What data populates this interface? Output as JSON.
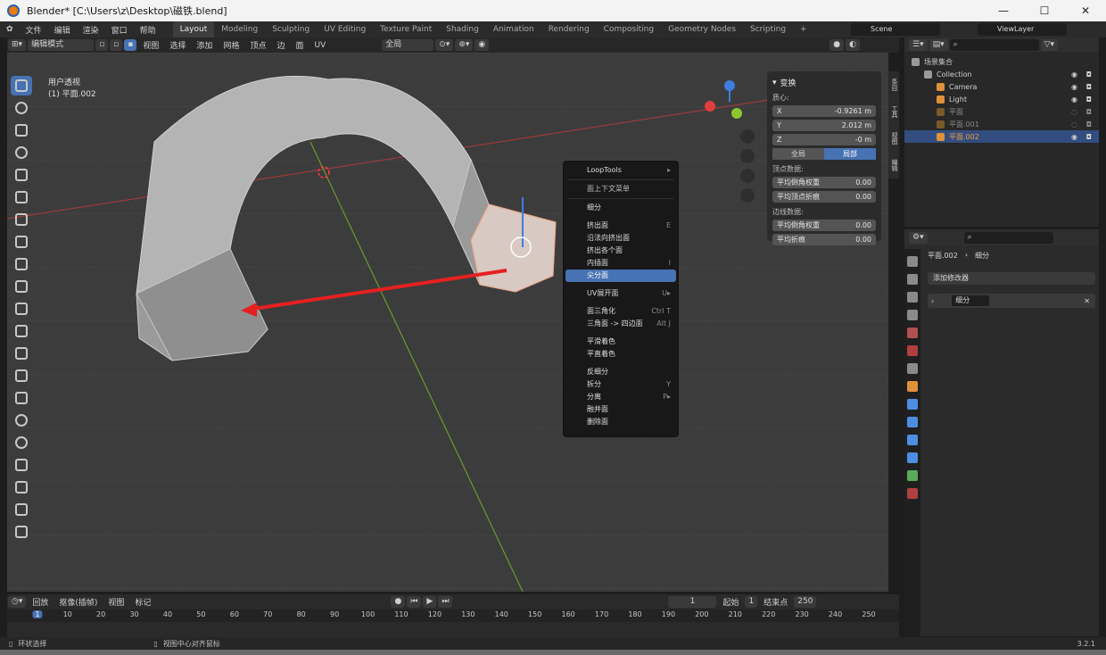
{
  "window": {
    "title": "Blender* [C:\\Users\\z\\Desktop\\磁铁.blend]",
    "controls": [
      "—",
      "☐",
      "✕"
    ]
  },
  "menubar": {
    "items": [
      "文件",
      "编辑",
      "渲染",
      "窗口",
      "帮助"
    ]
  },
  "workspaces": [
    "Layout",
    "Modeling",
    "Sculpting",
    "UV Editing",
    "Texture Paint",
    "Shading",
    "Animation",
    "Rendering",
    "Compositing",
    "Geometry Nodes",
    "Scripting",
    "+"
  ],
  "scene": {
    "name": "Scene",
    "view_layer": "ViewLayer"
  },
  "viewport_header": {
    "mode": "编辑模式",
    "menus": [
      "视图",
      "选择",
      "添加",
      "网格",
      "顶点",
      "边",
      "面",
      "UV"
    ],
    "transform": "全局",
    "options": "选项",
    "axes": [
      "X",
      "Y",
      "Z"
    ]
  },
  "viewport": {
    "view_name": "用户透视",
    "object_name": "(1) 平面.002"
  },
  "npanel": {
    "section": "变换",
    "median_label": "质心:",
    "x_label": "X",
    "x_value": "-0.9261 m",
    "y_label": "Y",
    "y_value": "2.012 m",
    "z_label": "Z",
    "z_value": "-0 m",
    "global": "全局",
    "local": "局部",
    "vertex_data": "顶点数据:",
    "mean_bevel_weight": "平均倒角权重",
    "mean_bevel_weight_value": "0.00",
    "mean_vertex_crease": "平均顶点折痕",
    "mean_vertex_crease_value": "0.00",
    "edge_data": "边线数据:",
    "edge_bevel_weight": "平均倒角权重",
    "edge_bevel_weight_value": "0.00",
    "edge_crease": "平均折痕",
    "edge_crease_value": "0.00",
    "side_tabs": [
      "条目",
      "工具",
      "视图",
      "编辑"
    ]
  },
  "context_menu": {
    "items": [
      {
        "label": "LoopTools",
        "shortcut": "▸"
      },
      {
        "label": "面上下文菜单",
        "shortcut": ""
      },
      {
        "label": "细分",
        "shortcut": ""
      },
      {
        "label": "挤出面",
        "shortcut": "E"
      },
      {
        "label": "沿法向挤出面",
        "shortcut": ""
      },
      {
        "label": "挤出各个面",
        "shortcut": ""
      },
      {
        "label": "内插面",
        "shortcut": "I"
      },
      {
        "label": "尖分面",
        "shortcut": ""
      },
      {
        "label": "UV展开面",
        "shortcut": "U▸"
      },
      {
        "label": "面三角化",
        "shortcut": "Ctrl T"
      },
      {
        "label": "三角面 -> 四边面",
        "shortcut": "Alt J"
      },
      {
        "label": "平滑着色",
        "shortcut": ""
      },
      {
        "label": "平直着色",
        "shortcut": ""
      },
      {
        "label": "反细分",
        "shortcut": ""
      },
      {
        "label": "拆分",
        "shortcut": "Y"
      },
      {
        "label": "分离",
        "shortcut": "P▸"
      },
      {
        "label": "融并面",
        "shortcut": ""
      },
      {
        "label": "删除面",
        "shortcut": ""
      }
    ],
    "highlighted": "尖分面"
  },
  "outliner": {
    "root": "场景集合",
    "items": [
      {
        "label": "Collection",
        "color": "#9a9a9a"
      },
      {
        "label": "Camera",
        "color": "#e0913a"
      },
      {
        "label": "Light",
        "color": "#e0913a"
      },
      {
        "label": "平面",
        "color": "#e0913a"
      },
      {
        "label": "平面.001",
        "color": "#e0913a"
      },
      {
        "label": "平面.002",
        "color": "#e0913a"
      }
    ]
  },
  "properties": {
    "object": "平面.002",
    "modifier_path": "细分",
    "add_modifier": "添加修改器",
    "modifier_name": "细分"
  },
  "timeline": {
    "menus": [
      "回放",
      "抠像(插帧)",
      "视图",
      "标记"
    ],
    "current_frame": "1",
    "start_label": "起始",
    "start": "1",
    "end_label": "结束点",
    "end": "250",
    "ticks": [
      "1",
      "10",
      "20",
      "30",
      "40",
      "50",
      "60",
      "70",
      "80",
      "90",
      "100",
      "110",
      "120",
      "130",
      "140",
      "150",
      "160",
      "170",
      "180",
      "190",
      "200",
      "210",
      "220",
      "230",
      "240",
      "250"
    ]
  },
  "statusbar": {
    "left": "环状选择",
    "center": "视图中心对齐鼠标",
    "version": "3.2.1"
  },
  "colors": {
    "accent": "#4772b3",
    "axis_x": "#e03e3e",
    "axis_y": "#8ac62e",
    "axis_z": "#3e7de0"
  }
}
